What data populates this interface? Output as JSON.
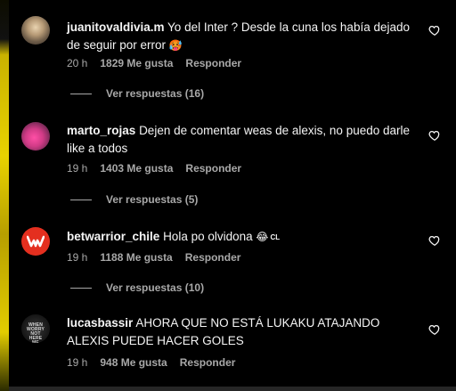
{
  "comments": [
    {
      "username": "juanitovaldivia.m",
      "text": "Yo del Inter ? Desde la cuna los había dejado de seguir por error",
      "emoji": "🥵",
      "time": "20 h",
      "likes": "1829 Me gusta",
      "reply_label": "Responder",
      "view_replies": "Ver respuestas (16)"
    },
    {
      "username": "marto_rojas",
      "text": "Dejen de comentar weas de alexis, no puedo darle like a todos",
      "time": "19 h",
      "likes": "1403 Me gusta",
      "reply_label": "Responder",
      "view_replies": "Ver respuestas (5)"
    },
    {
      "username": "betwarrior_chile",
      "text": "Hola po olvidona",
      "emoji": "😂",
      "flag": "CL",
      "time": "19 h",
      "likes": "1188 Me gusta",
      "reply_label": "Responder",
      "view_replies": "Ver respuestas (10)"
    },
    {
      "username": "lucasbassir",
      "text": "AHORA QUE NO ESTÁ LUKAKU ATAJANDO ALEXIS PUEDE HACER GOLES",
      "avatar_text": "WHEN WORRY NOT HERE ME",
      "time": "19 h",
      "likes": "948 Me gusta",
      "reply_label": "Responder"
    }
  ],
  "icons": {
    "like": "heart-outline-icon",
    "avatar_brand": "betwarrior-w-logo"
  },
  "colors": {
    "background": "#000000",
    "text": "#f5f5f5",
    "secondary": "#a8a8a8",
    "betwarrior_red": "#e42f1f"
  }
}
